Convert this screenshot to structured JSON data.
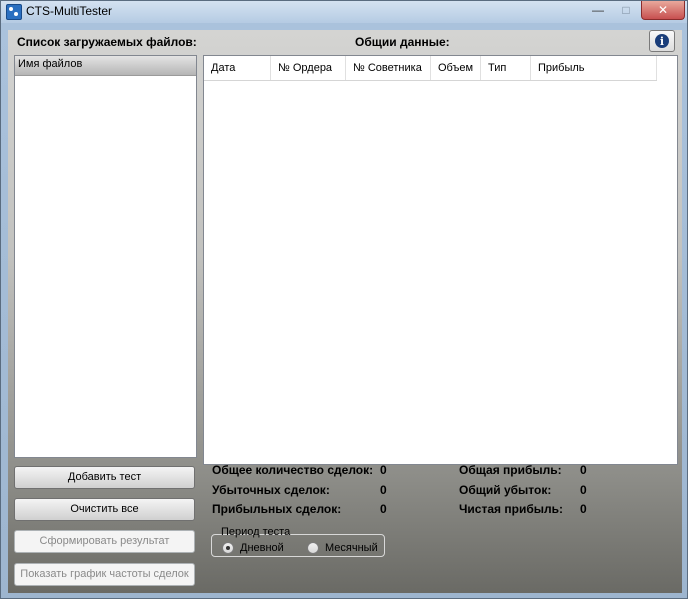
{
  "window": {
    "title": "CTS-MultiTester",
    "controls": {
      "minimize": "—",
      "maximize": "□",
      "close": "✕"
    }
  },
  "labels": {
    "file_list_title": "Список загружаемых файлов:",
    "general_data_title": "Общии данные:"
  },
  "file_list": {
    "header": "Имя файлов",
    "items": []
  },
  "grid": {
    "columns": [
      "Дата",
      "№ Ордера",
      "№ Советника",
      "Объем",
      "Тип",
      "Прибыль"
    ],
    "rows": []
  },
  "buttons": {
    "add_test": "Добавить тест",
    "clear_all": "Очистить все",
    "build_result": "Сформировать результат",
    "show_chart": "Показать график частоты сделок"
  },
  "stats": {
    "total_deals_label": "Общее количество сделок:",
    "total_deals_value": "0",
    "loss_deals_label": "Убыточных сделок:",
    "loss_deals_value": "0",
    "profit_deals_label": "Прибыльных сделок:",
    "profit_deals_value": "0",
    "total_profit_label": "Общая прибыль:",
    "total_profit_value": "0",
    "total_loss_label": "Общий убыток:",
    "total_loss_value": "0",
    "net_profit_label": "Чистая прибыль:",
    "net_profit_value": "0"
  },
  "test_period": {
    "legend": "Период теста",
    "options": [
      {
        "label": "Дневной",
        "checked": true
      },
      {
        "label": "Месячный",
        "checked": false
      }
    ]
  }
}
